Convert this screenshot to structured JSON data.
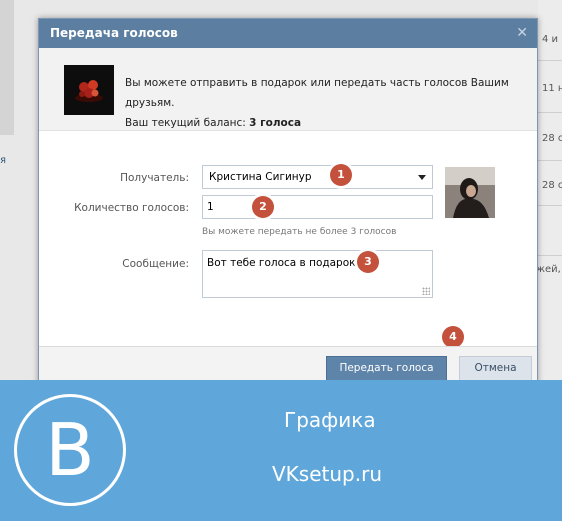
{
  "background": {
    "left_link": "я",
    "right_items": [
      "4 и",
      "11 н",
      "28 с",
      "28 с",
      "жей, е"
    ]
  },
  "dialog": {
    "title": "Передача голосов",
    "close_icon": "close-icon",
    "info": {
      "line1": "Вы можете отправить в подарок или передать часть голосов Вашим друзьям.",
      "balance_label": "Ваш текущий баланс:",
      "balance_value": "3 голоса"
    },
    "form": {
      "recipient_label": "Получатель:",
      "recipient_value": "Кристина Сигинур",
      "votes_label": "Количество голосов:",
      "votes_value": "1",
      "votes_hint": "Вы можете передать не более 3 голосов",
      "message_label": "Сообщение:",
      "message_value": "Вот тебе голоса в подарок"
    },
    "markers": [
      "1",
      "2",
      "3",
      "4"
    ],
    "buttons": {
      "submit": "Передать голоса",
      "cancel": "Отмена"
    }
  },
  "banner": {
    "logo_letter": "B",
    "title": "Графика",
    "site": "VKsetup.ru"
  },
  "colors": {
    "header": "#5b7ea1",
    "primary_button": "#5f84aa",
    "marker": "#c4513b",
    "banner": "#5fa7db"
  }
}
